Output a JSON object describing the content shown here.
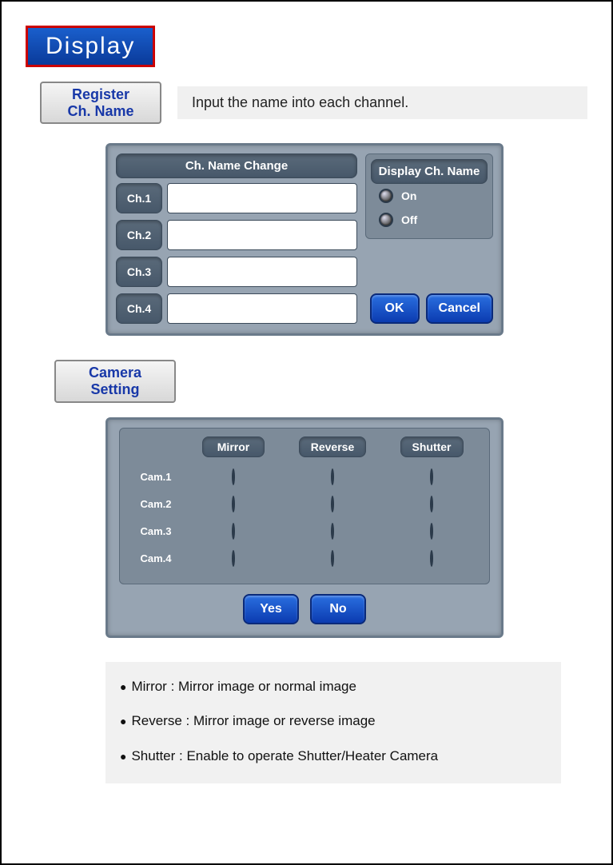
{
  "title": "Display",
  "sections": {
    "register": {
      "button_line1": "Register",
      "button_line2": "Ch. Name",
      "description": "Input the name into each channel.",
      "dialog": {
        "left_header": "Ch. Name Change",
        "channels": [
          "Ch.1",
          "Ch.2",
          "Ch.3",
          "Ch.4"
        ],
        "values": [
          "",
          "",
          "",
          ""
        ],
        "right_header": "Display Ch. Name",
        "options": [
          "On",
          "Off"
        ],
        "ok": "OK",
        "cancel": "Cancel"
      }
    },
    "camera": {
      "button_line1": "Camera",
      "button_line2": "Setting",
      "dialog": {
        "columns": [
          "Mirror",
          "Reverse",
          "Shutter"
        ],
        "rows": [
          "Cam.1",
          "Cam.2",
          "Cam.3",
          "Cam.4"
        ],
        "yes": "Yes",
        "no": "No"
      },
      "notes": [
        "Mirror : Mirror image or normal image",
        "Reverse : Mirror image or reverse image",
        "Shutter : Enable to operate Shutter/Heater Camera"
      ]
    }
  }
}
